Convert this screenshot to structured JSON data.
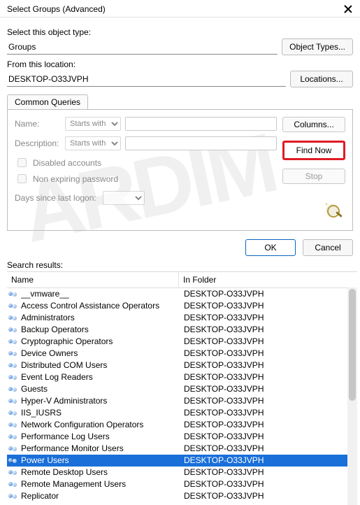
{
  "title": "Select Groups (Advanced)",
  "object_type_label": "Select this object type:",
  "object_type_value": "Groups",
  "object_types_btn": "Object Types...",
  "location_label": "From this location:",
  "location_value": "DESKTOP-O33JVPH",
  "locations_btn": "Locations...",
  "tab": "Common Queries",
  "query": {
    "name_label": "Name:",
    "desc_label": "Description:",
    "starts_with": "Starts with",
    "disabled_label": "Disabled accounts",
    "nonexp_label": "Non expiring password",
    "days_label": "Days since last logon:"
  },
  "buttons": {
    "columns": "Columns...",
    "find_now": "Find Now",
    "stop": "Stop",
    "ok": "OK",
    "cancel": "Cancel"
  },
  "results_label": "Search results:",
  "columns": {
    "name": "Name",
    "folder": "In Folder"
  },
  "results": [
    {
      "name": "__vmware__",
      "folder": "DESKTOP-O33JVPH",
      "selected": false
    },
    {
      "name": "Access Control Assistance Operators",
      "folder": "DESKTOP-O33JVPH",
      "selected": false
    },
    {
      "name": "Administrators",
      "folder": "DESKTOP-O33JVPH",
      "selected": false
    },
    {
      "name": "Backup Operators",
      "folder": "DESKTOP-O33JVPH",
      "selected": false
    },
    {
      "name": "Cryptographic Operators",
      "folder": "DESKTOP-O33JVPH",
      "selected": false
    },
    {
      "name": "Device Owners",
      "folder": "DESKTOP-O33JVPH",
      "selected": false
    },
    {
      "name": "Distributed COM Users",
      "folder": "DESKTOP-O33JVPH",
      "selected": false
    },
    {
      "name": "Event Log Readers",
      "folder": "DESKTOP-O33JVPH",
      "selected": false
    },
    {
      "name": "Guests",
      "folder": "DESKTOP-O33JVPH",
      "selected": false
    },
    {
      "name": "Hyper-V Administrators",
      "folder": "DESKTOP-O33JVPH",
      "selected": false
    },
    {
      "name": "IIS_IUSRS",
      "folder": "DESKTOP-O33JVPH",
      "selected": false
    },
    {
      "name": "Network Configuration Operators",
      "folder": "DESKTOP-O33JVPH",
      "selected": false
    },
    {
      "name": "Performance Log Users",
      "folder": "DESKTOP-O33JVPH",
      "selected": false
    },
    {
      "name": "Performance Monitor Users",
      "folder": "DESKTOP-O33JVPH",
      "selected": false
    },
    {
      "name": "Power Users",
      "folder": "DESKTOP-O33JVPH",
      "selected": true
    },
    {
      "name": "Remote Desktop Users",
      "folder": "DESKTOP-O33JVPH",
      "selected": false
    },
    {
      "name": "Remote Management Users",
      "folder": "DESKTOP-O33JVPH",
      "selected": false
    },
    {
      "name": "Replicator",
      "folder": "DESKTOP-O33JVPH",
      "selected": false
    }
  ]
}
